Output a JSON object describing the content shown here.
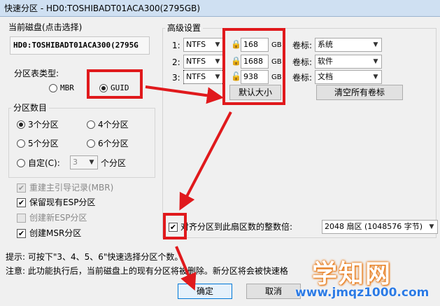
{
  "window": {
    "title": "快速分区 - HD0:TOSHIBADT01ACA300(2795GB)"
  },
  "disk": {
    "group_label": "当前磁盘(点击选择)",
    "name": "HD0:TOSHIBADT01ACA300(2795G"
  },
  "partition_table": {
    "label": "分区表类型:",
    "options": [
      "MBR",
      "GUID"
    ],
    "selected": "GUID"
  },
  "partition_count": {
    "group_label": "分区数目",
    "options": [
      "3个分区",
      "4个分区",
      "5个分区",
      "6个分区"
    ],
    "selected": "3个分区",
    "custom_label": "自定(C):",
    "custom_value": "3",
    "custom_suffix": "个分区"
  },
  "options": [
    {
      "label": "重建主引导记录(MBR)",
      "checked": true,
      "enabled": false
    },
    {
      "label": "保留现有ESP分区",
      "checked": true,
      "enabled": true
    },
    {
      "label": "创建新ESP分区",
      "checked": false,
      "enabled": false
    },
    {
      "label": "创建MSR分区",
      "checked": true,
      "enabled": true
    }
  ],
  "advanced": {
    "group_label": "高级设置",
    "rows": [
      {
        "index": "1:",
        "fs": "NTFS",
        "size": "168",
        "unit": "GB",
        "label_prefix": "卷标:",
        "volume": "系统"
      },
      {
        "index": "2:",
        "fs": "NTFS",
        "size": "1688",
        "unit": "GB",
        "label_prefix": "卷标:",
        "volume": "软件"
      },
      {
        "index": "3:",
        "fs": "NTFS",
        "size": "938",
        "unit": "GB",
        "label_prefix": "卷标:",
        "volume": "文档"
      }
    ],
    "default_size_button": "默认大小",
    "clear_labels_button": "清空所有卷标"
  },
  "align": {
    "label": "对齐分区到此扇区数的整数倍:",
    "checked": true,
    "value": "2048 扇区 (1048576 字节)"
  },
  "hint": "提示: 可按下\"3、4、5、6\"快速选择分区个数。",
  "note": "注意: 此功能执行后，当前磁盘上的现有分区将被删除。新分区将会被快速格",
  "buttons": {
    "ok": "确定",
    "cancel": "取消"
  },
  "watermark": {
    "brand": "学知网",
    "url": "www.jmqz1000.com"
  },
  "colors": {
    "annotation_red": "#e0191c",
    "watermark_blue": "#2c7be5"
  }
}
